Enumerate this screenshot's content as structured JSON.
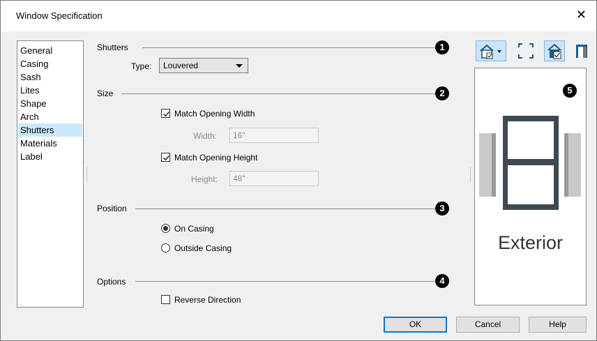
{
  "window": {
    "title": "Window Specification",
    "close_glyph": "✕"
  },
  "nav": {
    "items": [
      {
        "label": "General",
        "selected": false
      },
      {
        "label": "Casing",
        "selected": false
      },
      {
        "label": "Sash",
        "selected": false
      },
      {
        "label": "Lites",
        "selected": false
      },
      {
        "label": "Shape",
        "selected": false
      },
      {
        "label": "Arch",
        "selected": false
      },
      {
        "label": "Shutters",
        "selected": true
      },
      {
        "label": "Materials",
        "selected": false
      },
      {
        "label": "Label",
        "selected": false
      }
    ]
  },
  "shutters": {
    "label": "Shutters",
    "badge": "1",
    "type_label": "Type:",
    "type_value": "Louvered"
  },
  "size": {
    "label": "Size",
    "badge": "2",
    "match_width_label": "Match Opening Width",
    "match_width_checked": true,
    "width_label": "Width:",
    "width_value": "16\"",
    "match_height_label": "Match Opening Height",
    "match_height_checked": true,
    "height_label": "Height:",
    "height_value": "48\""
  },
  "position": {
    "label": "Position",
    "badge": "3",
    "on_casing_label": "On Casing",
    "outside_casing_label": "Outside Casing",
    "selected": "On Casing"
  },
  "options": {
    "label": "Options",
    "badge": "4",
    "reverse_label": "Reverse Direction",
    "reverse_checked": false
  },
  "preview": {
    "badge": "5",
    "caption": "Exterior"
  },
  "toolbar": {
    "icons": [
      "house-view-dropdown-icon",
      "fill-window-icon",
      "window-view-icon",
      "shutter-view-icon"
    ]
  },
  "buttons": {
    "ok": "OK",
    "cancel": "Cancel",
    "help": "Help"
  },
  "colors": {
    "selection": "#cce8ff",
    "accent": "#0078d7",
    "dialog_bg": "#f0f0f0"
  }
}
